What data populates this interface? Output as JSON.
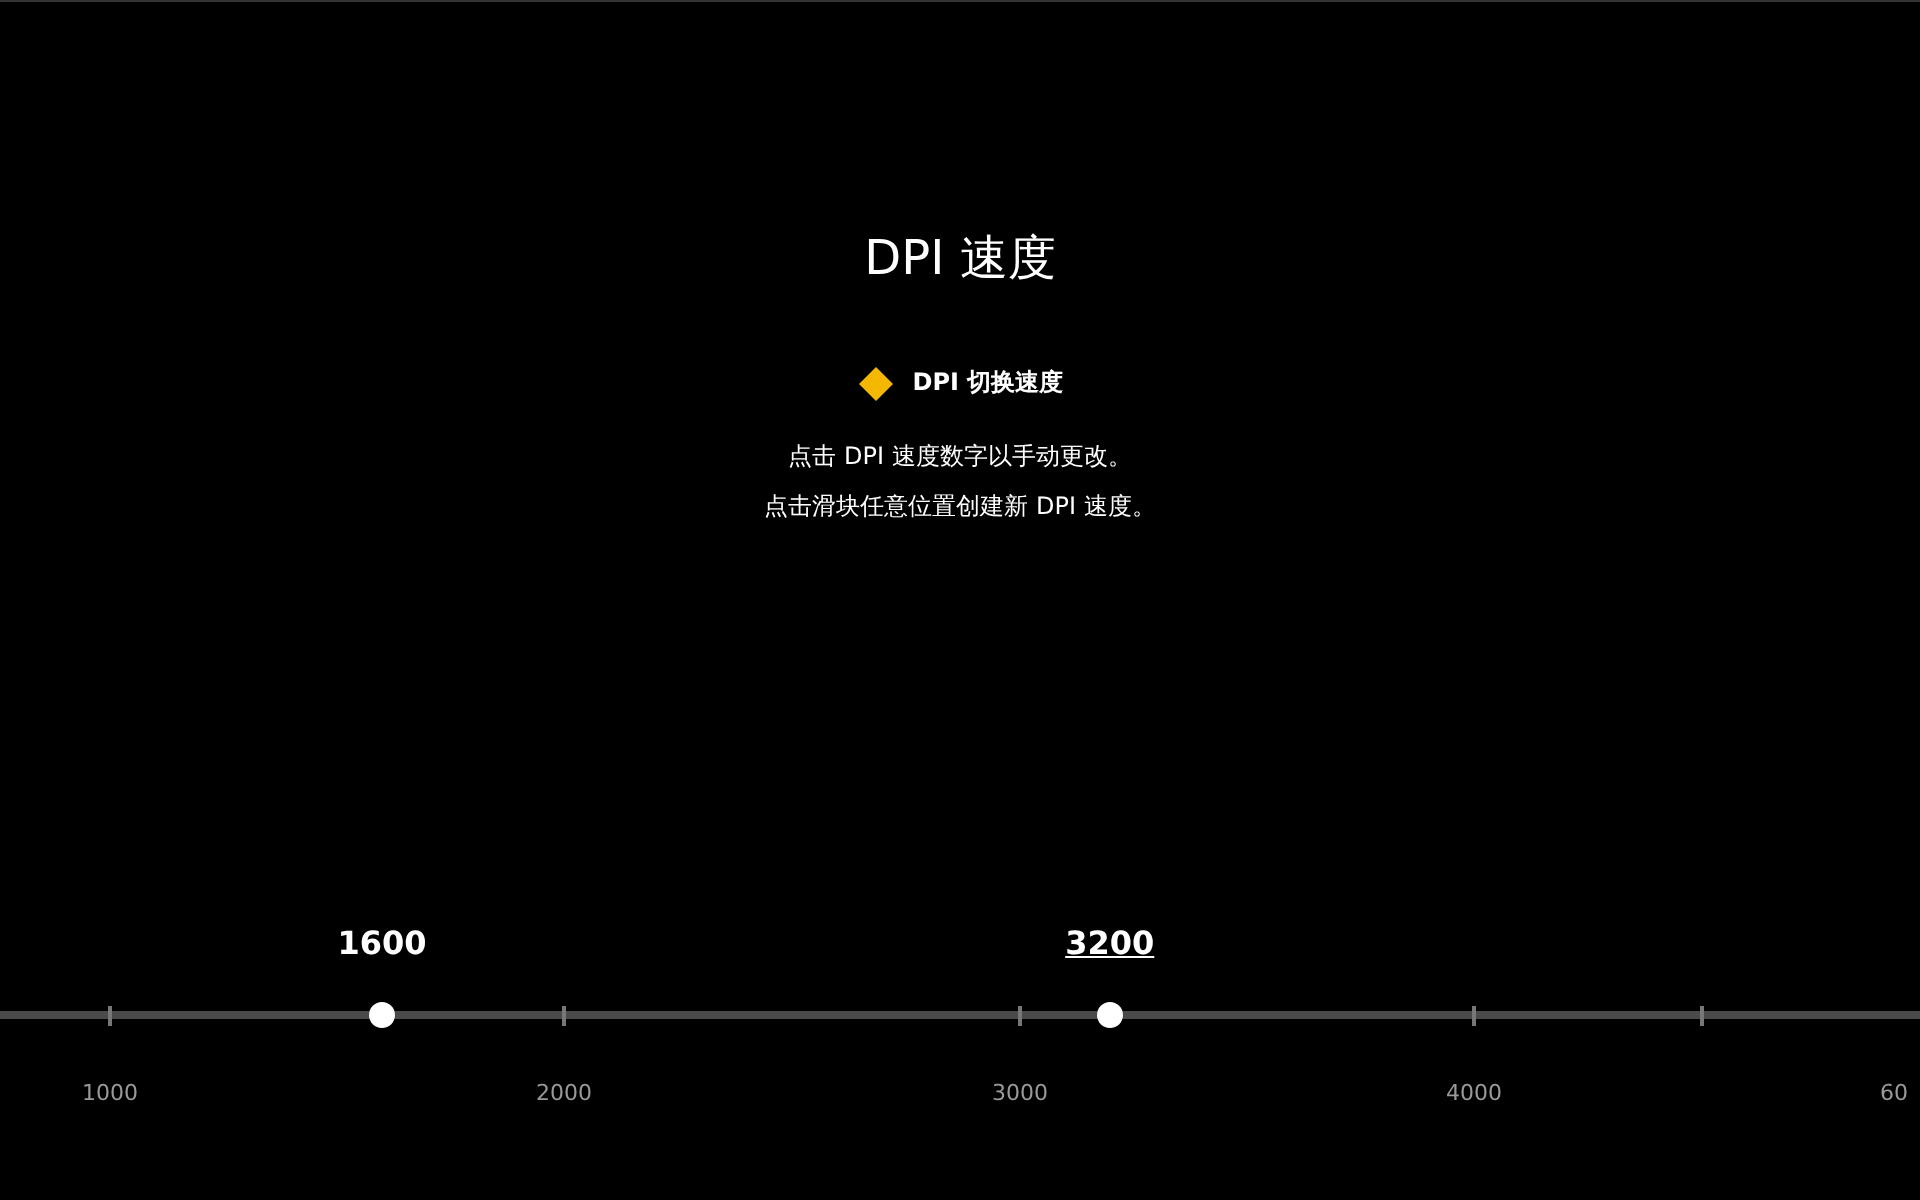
{
  "title": "DPI 速度",
  "legend": {
    "label": "DPI 切换速度"
  },
  "hints": [
    "点击 DPI 速度数字以手动更改。",
    "点击滑块任意位置创建新 DPI 速度。"
  ],
  "slider": {
    "thumbs": [
      {
        "value": "1600",
        "level": 0.199,
        "selected": false
      },
      {
        "value": "3200",
        "level": 0.578,
        "selected": true
      }
    ],
    "ticks": [
      {
        "level": 0.0573,
        "label": "1000"
      },
      {
        "level": 0.2938,
        "label": "2000"
      },
      {
        "level": 0.5313,
        "label": "3000"
      },
      {
        "level": 0.7677,
        "label": "4000"
      },
      {
        "level": 0.8865
      }
    ],
    "edge_label": "60"
  }
}
